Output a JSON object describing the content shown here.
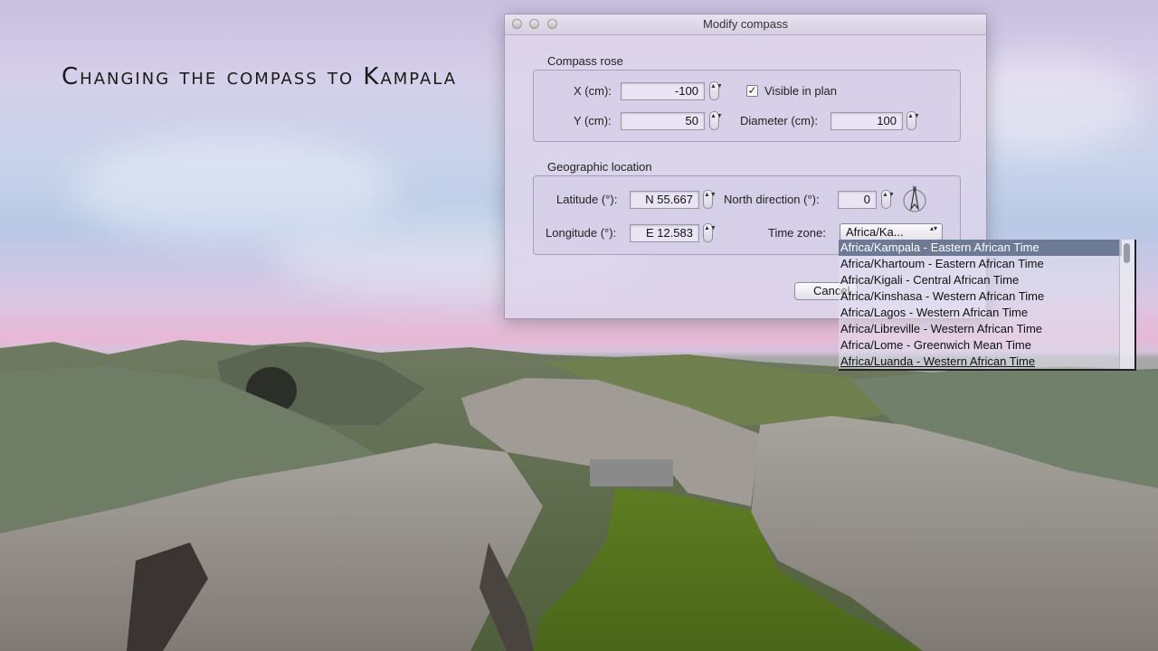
{
  "caption": "Changing the compass to Kampala",
  "dialog": {
    "title": "Modify compass",
    "compass_rose": {
      "section_label": "Compass rose",
      "x_label": "X (cm):",
      "x_value": "-100",
      "y_label": "Y (cm):",
      "y_value": "50",
      "visible_label": "Visible in plan",
      "visible_checked": true,
      "diameter_label": "Diameter (cm):",
      "diameter_value": "100"
    },
    "geo": {
      "section_label": "Geographic location",
      "latitude_label": "Latitude (°):",
      "latitude_value": "N 55.667",
      "north_label": "North direction (°):",
      "north_value": "0",
      "longitude_label": "Longitude (°):",
      "longitude_value": "E 12.583",
      "timezone_label": "Time zone:",
      "timezone_value": "Africa/Ka..."
    },
    "cancel_label": "Cancel",
    "check_glyph": "✓",
    "stepper_glyph": "▲▼",
    "popup_arrows": "▴▾"
  },
  "timezone_list": [
    "Africa/Kampala - Eastern African Time",
    "Africa/Khartoum - Eastern African Time",
    "Africa/Kigali - Central African Time",
    "Africa/Kinshasa - Western African Time",
    "Africa/Lagos - Western African Time",
    "Africa/Libreville - Western African Time",
    "Africa/Lome - Greenwich Mean Time",
    "Africa/Luanda - Western African Time"
  ],
  "colors": {
    "selection": "#6d7a96",
    "sky_top": "#c9bfe0",
    "horizon": "#e8b9d6",
    "rock": "#8e8c88",
    "grass": "#5f7a2a"
  }
}
